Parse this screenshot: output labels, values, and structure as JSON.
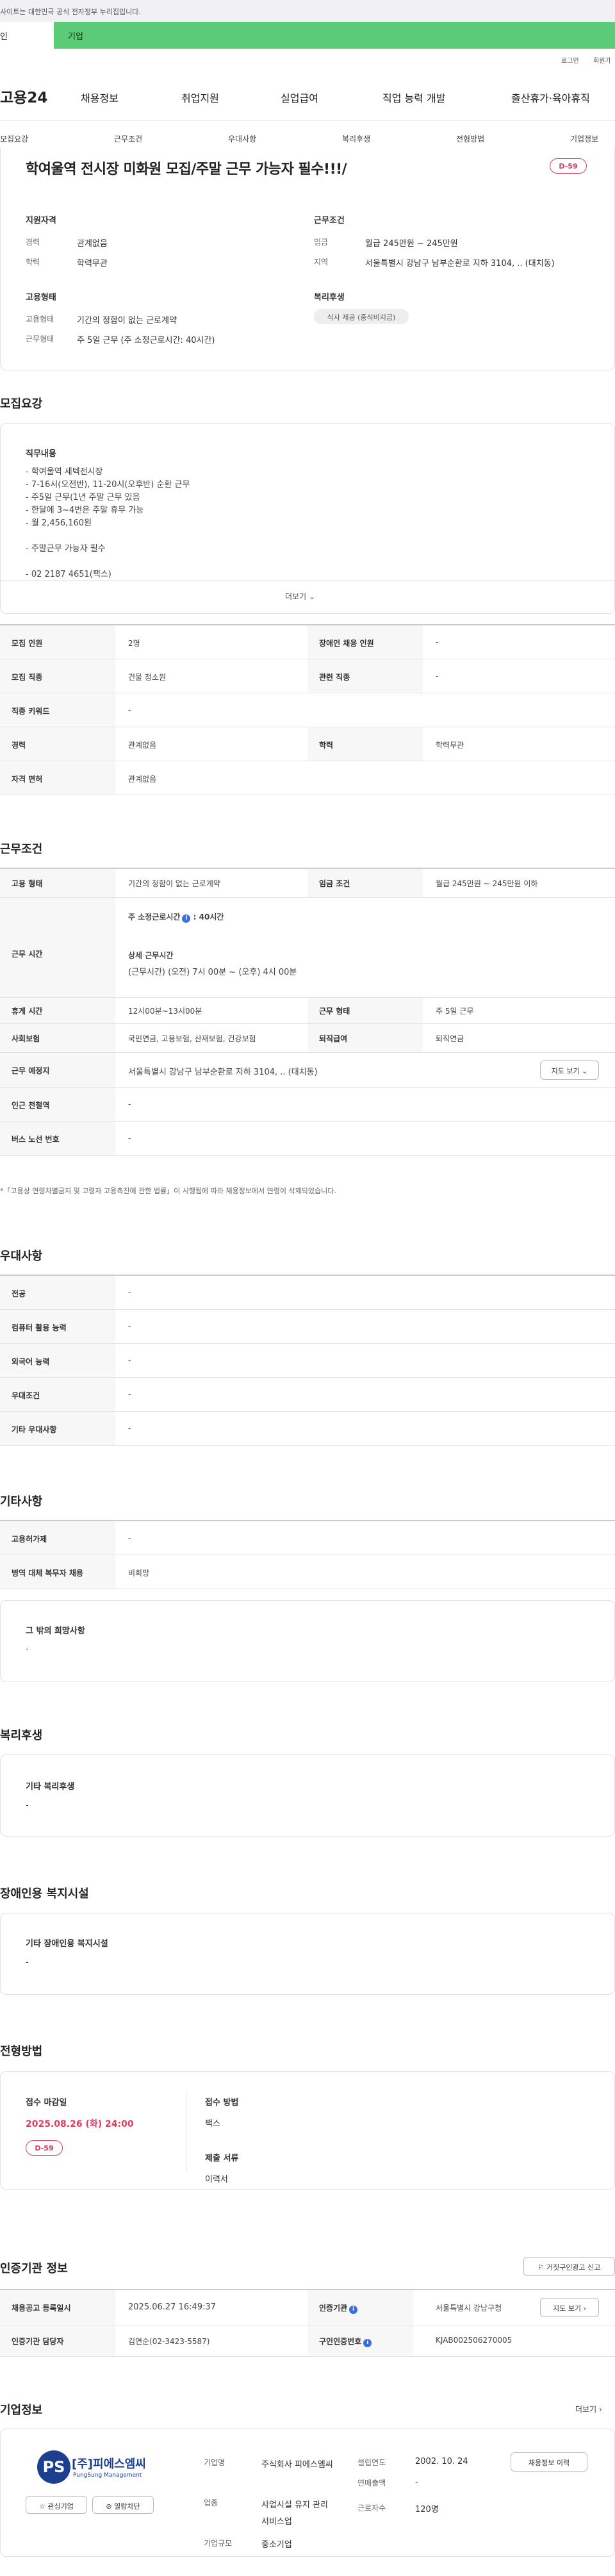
{
  "top_notice": "사이트는 대한민국 공식 전자정부 누리집입니다.",
  "user_tabs": [
    "인",
    "기업"
  ],
  "util_links": [
    "로그인",
    "회원가"
  ],
  "logo": "고용24",
  "gnb": [
    "채용정보",
    "취업지원",
    "실업급여",
    "직업 능력 개발",
    "출산휴가·육아휴직"
  ],
  "subnav": [
    "모집요강",
    "근무조건",
    "우대사항",
    "복리후생",
    "전형방법",
    "기업정보"
  ],
  "job_title": "학여울역 전시장 미화원 모집/주말 근무 가능자 필수!!!/",
  "dday": "D-59",
  "summary": {
    "req_head": "지원자격",
    "career_k": "경력",
    "career_v": "관계없음",
    "edu_k": "학력",
    "edu_v": "학력무관",
    "cond_head": "근무조건",
    "wage_k": "임금",
    "wage_v": "월급 245만원 ~ 245만원",
    "loc_k": "지역",
    "loc_v": "서울특별시 강남구 남부순환로 지하 3104, .. (대치동)",
    "emp_head": "고용형태",
    "etype_k": "고용형태",
    "etype_v": "기간의 정함이 없는 근로계약",
    "wtype_k": "근무형태",
    "wtype_v": "주 5일 근무 (주 소정근로시간: 40시간)",
    "welfare_head": "복리후생",
    "welfare_chip": "식사 제공 (중식비지급)"
  },
  "recruit": {
    "title": "모집요강",
    "job_head": "직무내용",
    "job_text": "- 학여울역 세텍전시장\n- 7-16시(오전반), 11-20시(오후반) 순환 근무\n- 주5일 근무(1년 주말 근무 있음\n- 한달에 3~4번은 주말 휴무 가능\n- 월 2,456,160원\n\n- 주말근무 가능자 필수\n\n- 02 2187 4651(팩스)",
    "more": "더보기",
    "rows": [
      {
        "k1": "모집 인원",
        "v1": "2명",
        "k2": "장애인 채용 인원",
        "v2": "-"
      },
      {
        "k1": "모집 직종",
        "v1": "건물 청소원",
        "k2": "관련 직종",
        "v2": "-"
      },
      {
        "k1": "직종 키워드",
        "v1": "-"
      },
      {
        "k1": "경력",
        "v1": "관계없음",
        "k2": "학력",
        "v2": "학력무관"
      },
      {
        "k1": "자격 면허",
        "v1": "관계없음"
      }
    ]
  },
  "conditions": {
    "title": "근무조건",
    "etype_k": "고용 형태",
    "etype_v": "기간의 정함이 없는 근로계약",
    "wage_k": "임금 조건",
    "wage_v": "월급 245만원 ~ 245만원 이하",
    "hours_k": "근무 시간",
    "hours_head": "주 소정근로시간",
    "hours_val": ": 40시간",
    "detail_head": "상세 근무시간",
    "detail_v": "(근무시간) (오전) 7시 00분 ~ (오후) 4시 00분",
    "rest_k": "휴게 시간",
    "rest_v": "12시00분~13시00분",
    "wtype_k": "근무 형태",
    "wtype_v": "주 5일 근무",
    "ins_k": "사회보험",
    "ins_v": "국민연금, 고용보험, 산재보험, 건강보험",
    "ret_k": "퇴직급여",
    "ret_v": "퇴직연금",
    "place_k": "근무 예정지",
    "place_v": "서울특별시 강남구 남부순환로 지하 3104, .. (대치동)",
    "map_btn": "지도 보기",
    "subway_k": "인근 전철역",
    "subway_v": "-",
    "bus_k": "버스 노선 번호",
    "bus_v": "-",
    "note": "*「고용상 연령차별금지 및 고령자 고용촉진에 관한 법률」이 시행됨에 따라 채용정보에서 연령이 삭제되었습니다."
  },
  "pref": {
    "title": "우대사항",
    "rows": [
      {
        "k": "전공",
        "v": "-"
      },
      {
        "k": "컴퓨터 활용 능력",
        "v": "-"
      },
      {
        "k": "외국어 능력",
        "v": "-"
      },
      {
        "k": "우대조건",
        "v": "-"
      },
      {
        "k": "기타 우대사항",
        "v": "-"
      }
    ]
  },
  "etc": {
    "title": "기타사항",
    "rows": [
      {
        "k": "고용허가제",
        "v": "-"
      },
      {
        "k": "병역 대체 복무자 채용",
        "v": "비희망"
      }
    ],
    "box_head": "그 밖의 희망사항",
    "box_v": "-"
  },
  "welfare": {
    "title": "복리후생",
    "box_head": "기타 복리후생",
    "box_v": "-"
  },
  "disabled": {
    "title": "장애인용 복지시설",
    "box_head": "기타 장애인용 복지시설",
    "box_v": "-"
  },
  "process": {
    "title": "전형방법",
    "deadline_head": "접수 마감일",
    "deadline_v": "2025.08.26 (화) 24:00",
    "dday": "D-59",
    "method_head": "접수 방법",
    "method_v": "팩스",
    "docs_head": "제출 서류",
    "docs_v": "이력서"
  },
  "cert": {
    "title": "인증기관 정보",
    "report_btn": "거짓구인광고 신고",
    "reg_k": "채용공고 등록일시",
    "reg_v": "2025.06.27 16:49:37",
    "org_k": "인증기관",
    "org_v": "서울특별시 강남구청",
    "map_btn": "지도 보기",
    "mgr_k": "인증기관 담당자",
    "mgr_v": "김연순(02-3423-5587)",
    "no_k": "구인인증번호",
    "no_v": "KJAB002506270005"
  },
  "company": {
    "title": "기업정보",
    "more": "더보기",
    "logo_main": "[주]피에스엠씨",
    "logo_en": "PungSung Management",
    "logo_ps": "PS",
    "fav_btn": "관심기업",
    "block_btn": "열람차단",
    "name_k": "기업명",
    "name_v": "주식회사 피에스엠씨",
    "ind_k": "업종",
    "ind_v": "사업시설 유지 관리 서비스업",
    "size_k": "기업규모",
    "size_v": "중소기업",
    "est_k": "설립연도",
    "est_v": "2002. 10. 24",
    "sales_k": "연매출액",
    "sales_v": "-",
    "emp_k": "근로자수",
    "emp_v": "120명",
    "jobs_btn": "채용정보 이력"
  }
}
